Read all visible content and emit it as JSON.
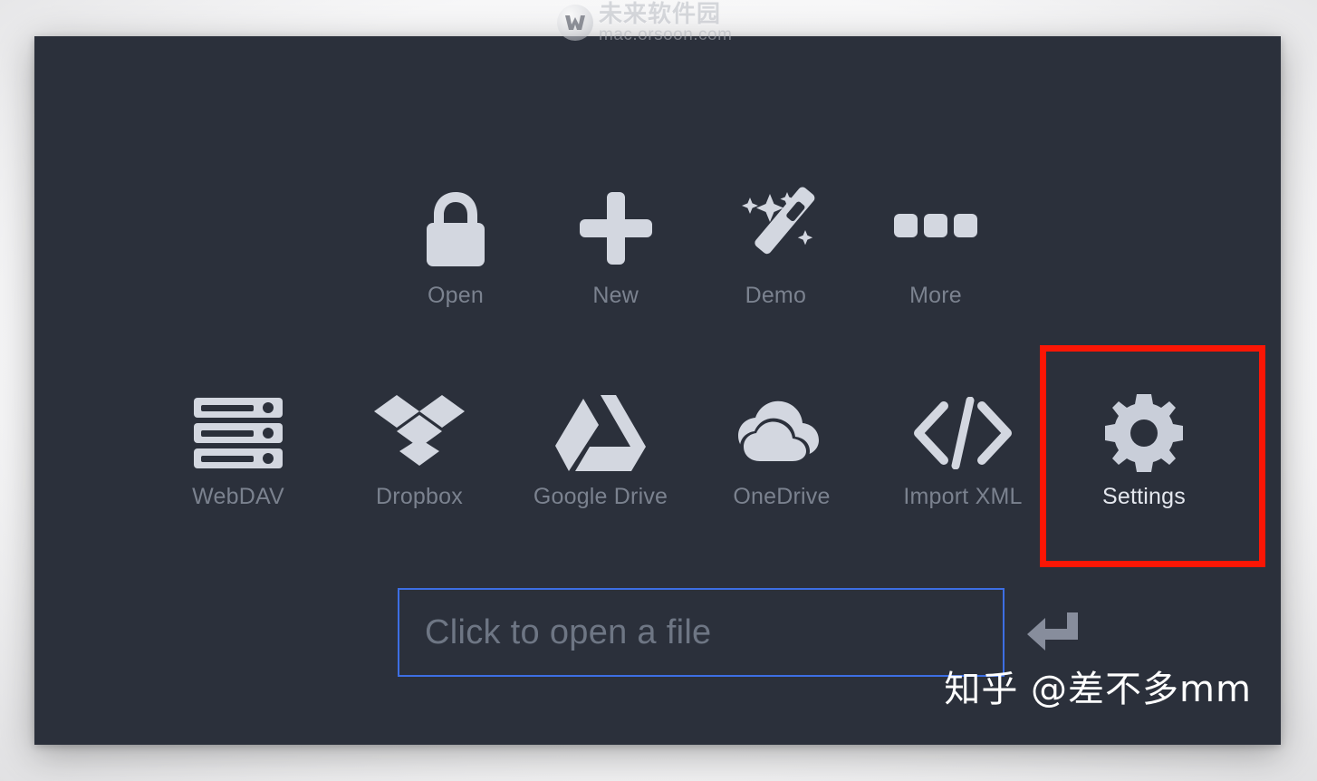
{
  "window": {
    "background_color": "#2b303b",
    "page_background_color": "#f2f2f4"
  },
  "primary_actions": [
    {
      "id": "open",
      "icon": "lock-icon",
      "label": "Open",
      "active": false
    },
    {
      "id": "new",
      "icon": "plus-icon",
      "label": "New",
      "active": false
    },
    {
      "id": "demo",
      "icon": "magic-wand-icon",
      "label": "Demo",
      "active": false
    },
    {
      "id": "more",
      "icon": "ellipsis-icon",
      "label": "More",
      "active": false
    }
  ],
  "service_actions": [
    {
      "id": "webdav",
      "icon": "server-icon",
      "label": "WebDAV",
      "active": false
    },
    {
      "id": "dropbox",
      "icon": "dropbox-icon",
      "label": "Dropbox",
      "active": false
    },
    {
      "id": "google-drive",
      "icon": "google-drive-icon",
      "label": "Google Drive",
      "active": false
    },
    {
      "id": "onedrive",
      "icon": "onedrive-cloud-icon",
      "label": "OneDrive",
      "active": false
    },
    {
      "id": "import-xml",
      "icon": "code-brackets-icon",
      "label": "Import XML",
      "active": false
    },
    {
      "id": "settings",
      "icon": "gear-icon",
      "label": "Settings",
      "active": true
    }
  ],
  "highlight": {
    "target": "settings",
    "color": "#fb1605",
    "border_width_px": 7
  },
  "open_file_bar": {
    "placeholder": "Click to open a file",
    "value": "",
    "border_color": "#3d6ee3",
    "enter_icon": "enter-return-arrow-icon"
  },
  "watermarks": {
    "top": {
      "logo_icon": "orsoon-w-logo-icon",
      "chinese": "未来软件园",
      "domain": "mac.orsoon.com"
    },
    "bottom": "知乎 @差不多mm"
  }
}
